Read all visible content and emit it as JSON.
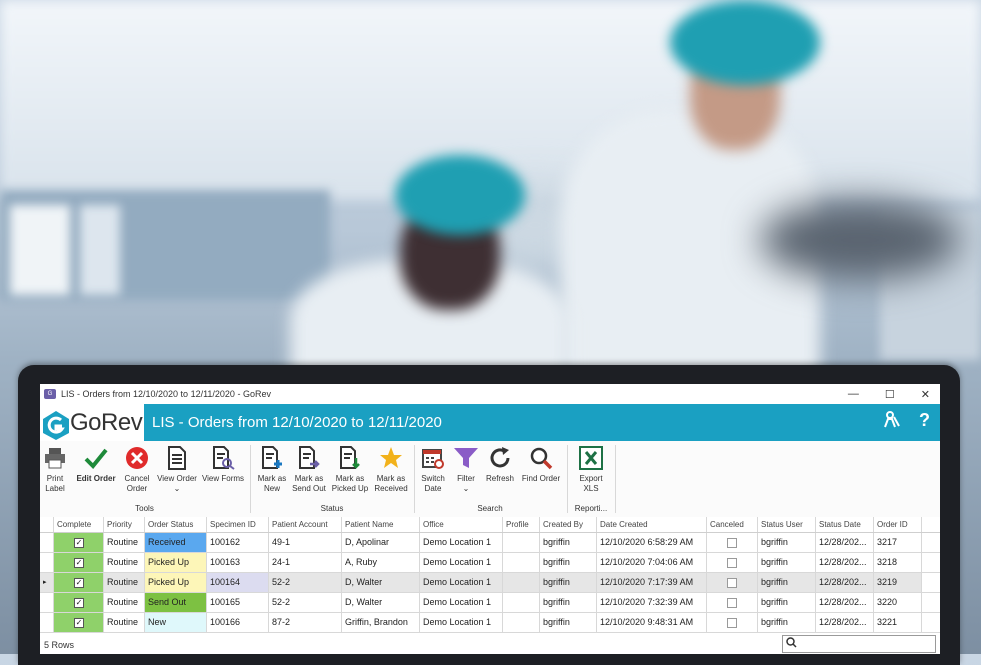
{
  "window": {
    "title": "LIS - Orders from 12/10/2020 to 12/11/2020 - GoRev",
    "controls": [
      "—",
      "☐",
      "✕"
    ]
  },
  "banner": {
    "logo_text": "GoRev",
    "title": "LIS - Orders from 12/10/2020 to 12/11/2020"
  },
  "ribbon": {
    "groups": {
      "tools": "Tools",
      "status": "Status",
      "search": "Search",
      "reporting": "Reporti..."
    },
    "buttons": {
      "print_label": [
        "Print",
        "Label"
      ],
      "edit_order": "Edit Order",
      "cancel_order": [
        "Cancel",
        "Order"
      ],
      "view_order": [
        "View Order",
        "⌄"
      ],
      "view_forms": "View Forms",
      "mark_new": [
        "Mark as",
        "New"
      ],
      "mark_sendout": [
        "Mark as",
        "Send Out"
      ],
      "mark_pickedup": [
        "Mark as",
        "Picked Up"
      ],
      "mark_received": [
        "Mark as",
        "Received"
      ],
      "switch_date": [
        "Switch",
        "Date"
      ],
      "filter": [
        "Filter",
        "⌄"
      ],
      "refresh": "Refresh",
      "find_order": "Find Order",
      "export_xls": [
        "Export",
        "XLS"
      ]
    }
  },
  "grid": {
    "columns": [
      "Complete",
      "Priority",
      "Order Status",
      "Specimen ID",
      "Patient Account",
      "Patient Name",
      "Office",
      "Profile",
      "Created By",
      "Date Created",
      "Canceled",
      "Status User",
      "Status Date",
      "Order ID"
    ],
    "rows": [
      {
        "complete": true,
        "priority": "Routine",
        "status": "Received",
        "specimen": "100162",
        "account": "49-1",
        "name": "D, Apolinar",
        "office": "Demo Location 1",
        "profile": "",
        "created_by": "bgriffin",
        "date_created": "12/10/2020 6:58:29 AM",
        "canceled": false,
        "status_user": "bgriffin",
        "status_date": "12/28/202...",
        "order_id": "3217",
        "status_color": "#5aa8ef"
      },
      {
        "complete": true,
        "priority": "Routine",
        "status": "Picked Up",
        "specimen": "100163",
        "account": "24-1",
        "name": "A, Ruby",
        "office": "Demo Location 1",
        "profile": "",
        "created_by": "bgriffin",
        "date_created": "12/10/2020 7:04:06 AM",
        "canceled": false,
        "status_user": "bgriffin",
        "status_date": "12/28/202...",
        "order_id": "3218",
        "status_color": "#fdf6b8"
      },
      {
        "complete": true,
        "priority": "Routine",
        "status": "Picked Up",
        "specimen": "100164",
        "account": "52-2",
        "name": "D, Walter",
        "office": "Demo Location 1",
        "profile": "",
        "created_by": "bgriffin",
        "date_created": "12/10/2020 7:17:39 AM",
        "canceled": false,
        "status_user": "bgriffin",
        "status_date": "12/28/202...",
        "order_id": "3219",
        "status_color": "#fdf6b8",
        "selected": true
      },
      {
        "complete": true,
        "priority": "Routine",
        "status": "Send Out",
        "specimen": "100165",
        "account": "52-2",
        "name": "D, Walter",
        "office": "Demo Location 1",
        "profile": "",
        "created_by": "bgriffin",
        "date_created": "12/10/2020 7:32:39 AM",
        "canceled": false,
        "status_user": "bgriffin",
        "status_date": "12/28/202...",
        "order_id": "3220",
        "status_color": "#7dc142"
      },
      {
        "complete": true,
        "priority": "Routine",
        "status": "New",
        "specimen": "100166",
        "account": "87-2",
        "name": "Griffin, Brandon",
        "office": "Demo Location 1",
        "profile": "",
        "created_by": "bgriffin",
        "date_created": "12/10/2020 9:48:31 AM",
        "canceled": false,
        "status_user": "bgriffin",
        "status_date": "12/28/202...",
        "order_id": "3221",
        "status_color": "#dff8fb"
      }
    ]
  },
  "footer": {
    "row_count": "5 Rows",
    "search_placeholder": ""
  }
}
